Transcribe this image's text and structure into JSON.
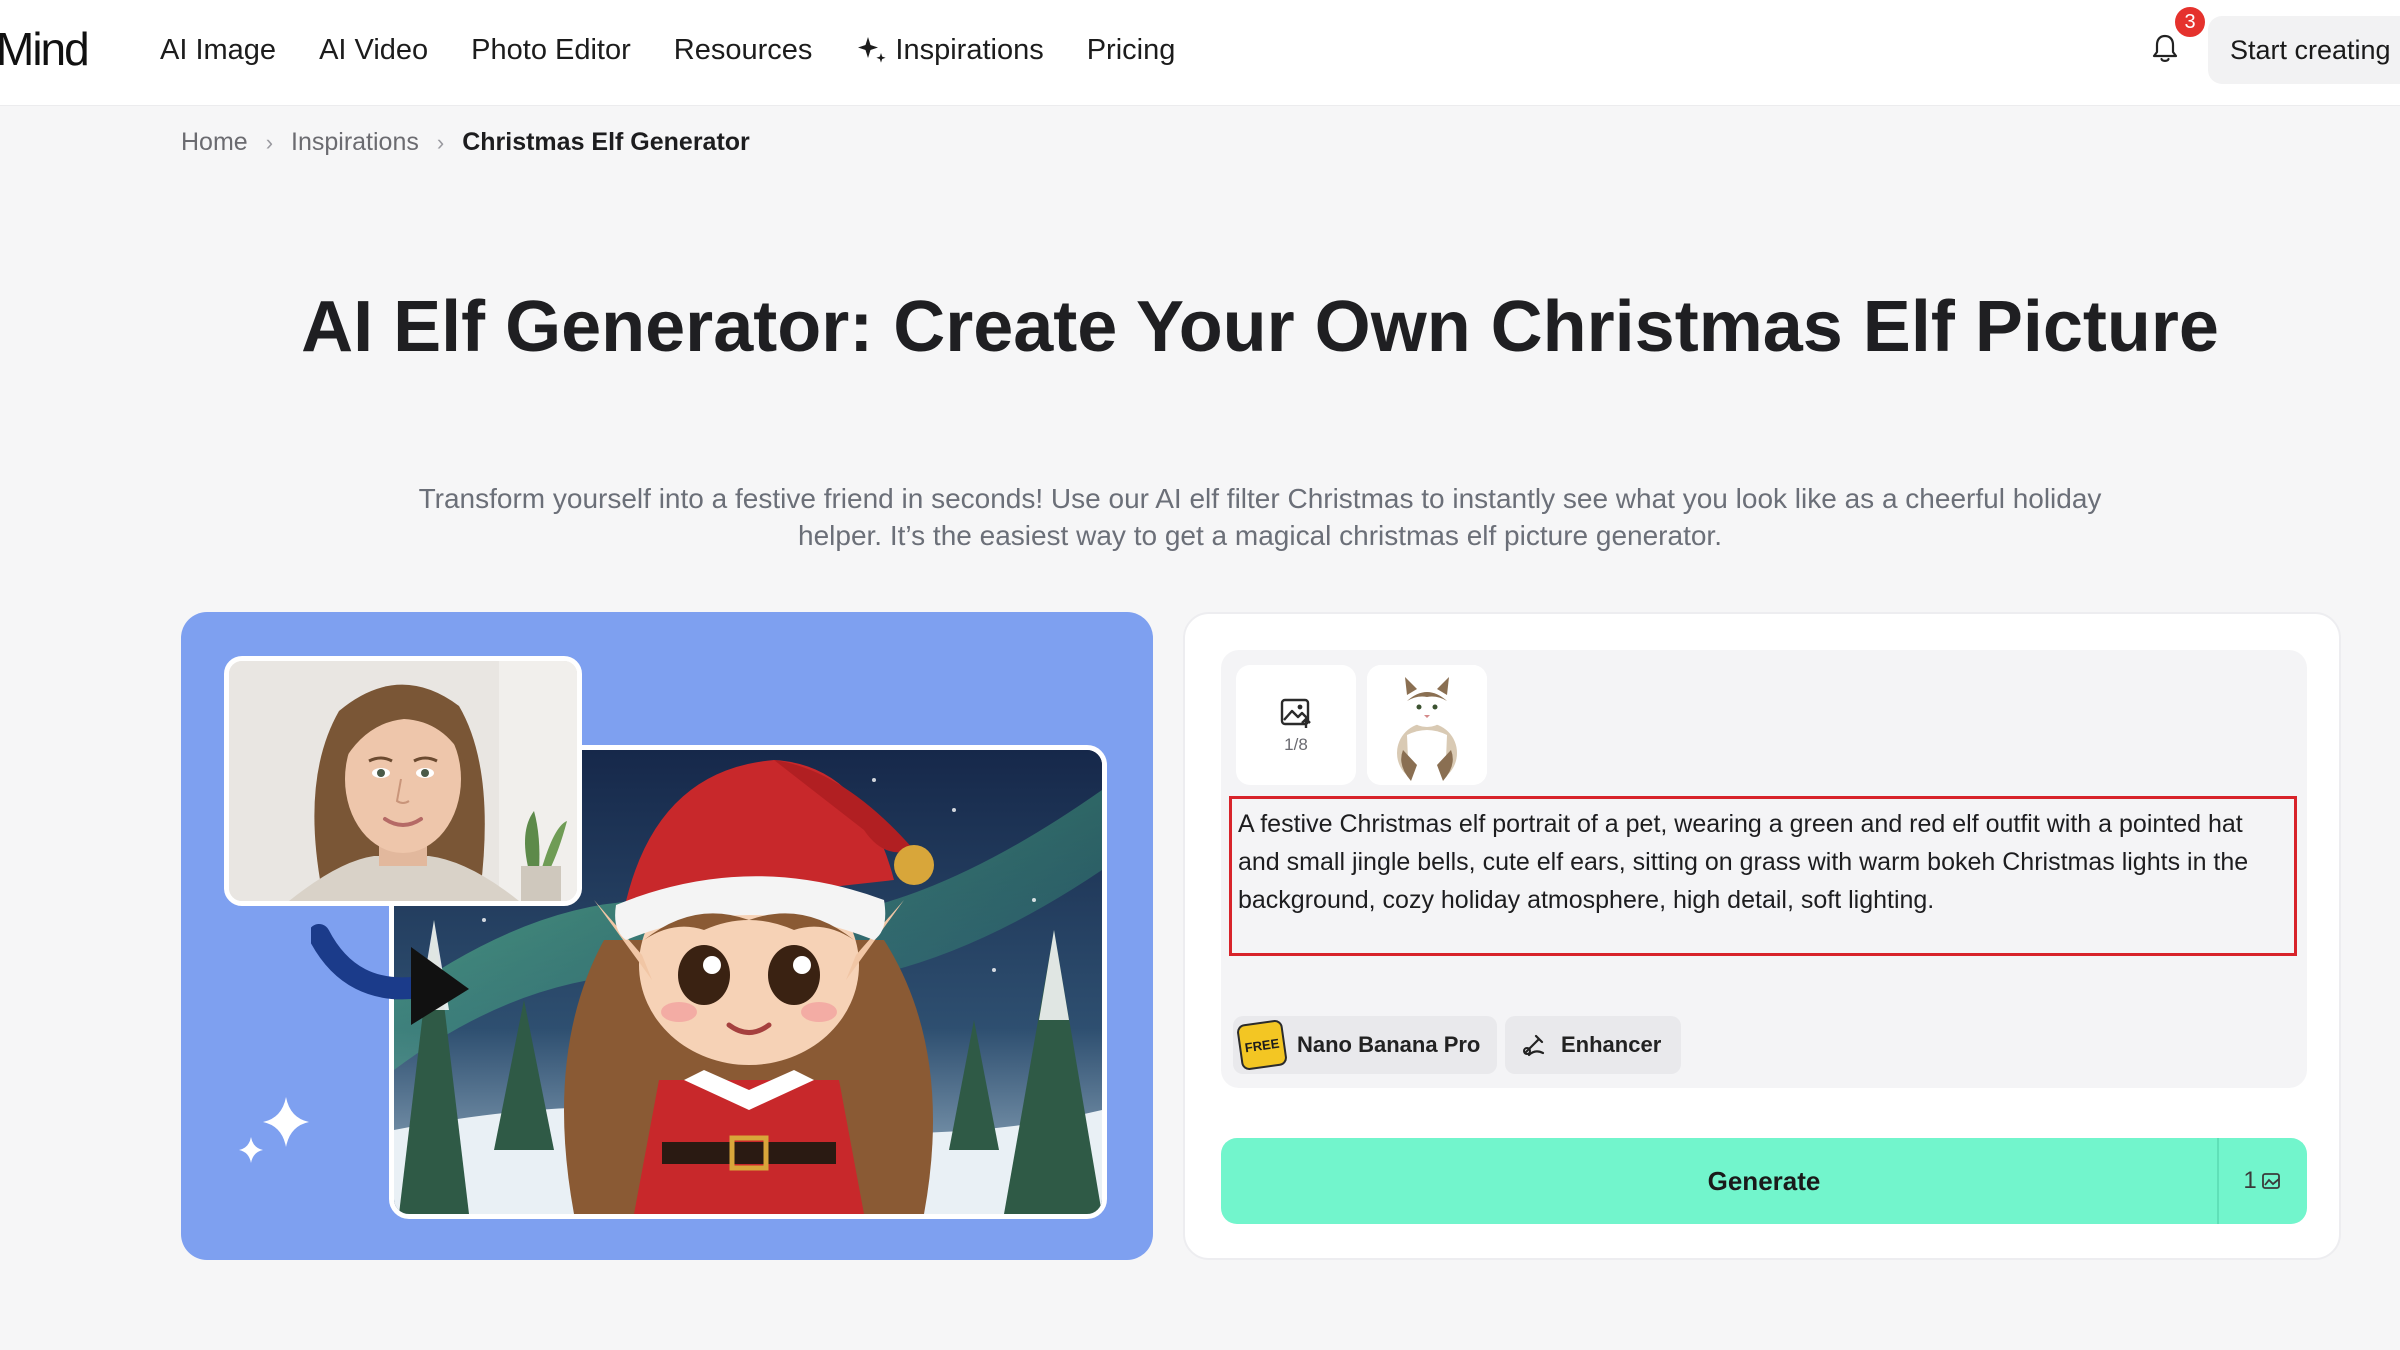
{
  "header": {
    "logo": "Mind",
    "nav": [
      "AI Image",
      "AI Video",
      "Photo Editor",
      "Resources",
      "Inspirations",
      "Pricing"
    ],
    "notification_count": "3",
    "start_label": "Start creating"
  },
  "breadcrumb": {
    "home": "Home",
    "section": "Inspirations",
    "current": "Christmas Elf Generator"
  },
  "hero": {
    "title": "AI Elf Generator: Create Your Own Christmas Elf Picture",
    "subtitle": "Transform yourself into a festive friend in seconds! Use our AI elf filter Christmas to instantly see what you look like as a cheerful holiday helper. It’s the easiest way to get a magical christmas elf picture generator."
  },
  "panel": {
    "upload_count": "1/8",
    "prompt": "A festive Christmas elf portrait of a pet, wearing a green and red elf outfit with a pointed hat and small jingle bells, cute elf ears, sitting on grass with warm bokeh Christmas lights in the background, cozy holiday atmosphere, high detail, soft lighting.",
    "model_badge": "FREE",
    "model_label": "Nano Banana Pro",
    "enhancer_label": "Enhancer",
    "generate_label": "Generate",
    "generate_cost": "1"
  },
  "colors": {
    "showcase_bg": "#7ea0f0",
    "generate_bg": "#72f5cc",
    "badge": "#e5322d",
    "prompt_border": "#d8232a"
  }
}
